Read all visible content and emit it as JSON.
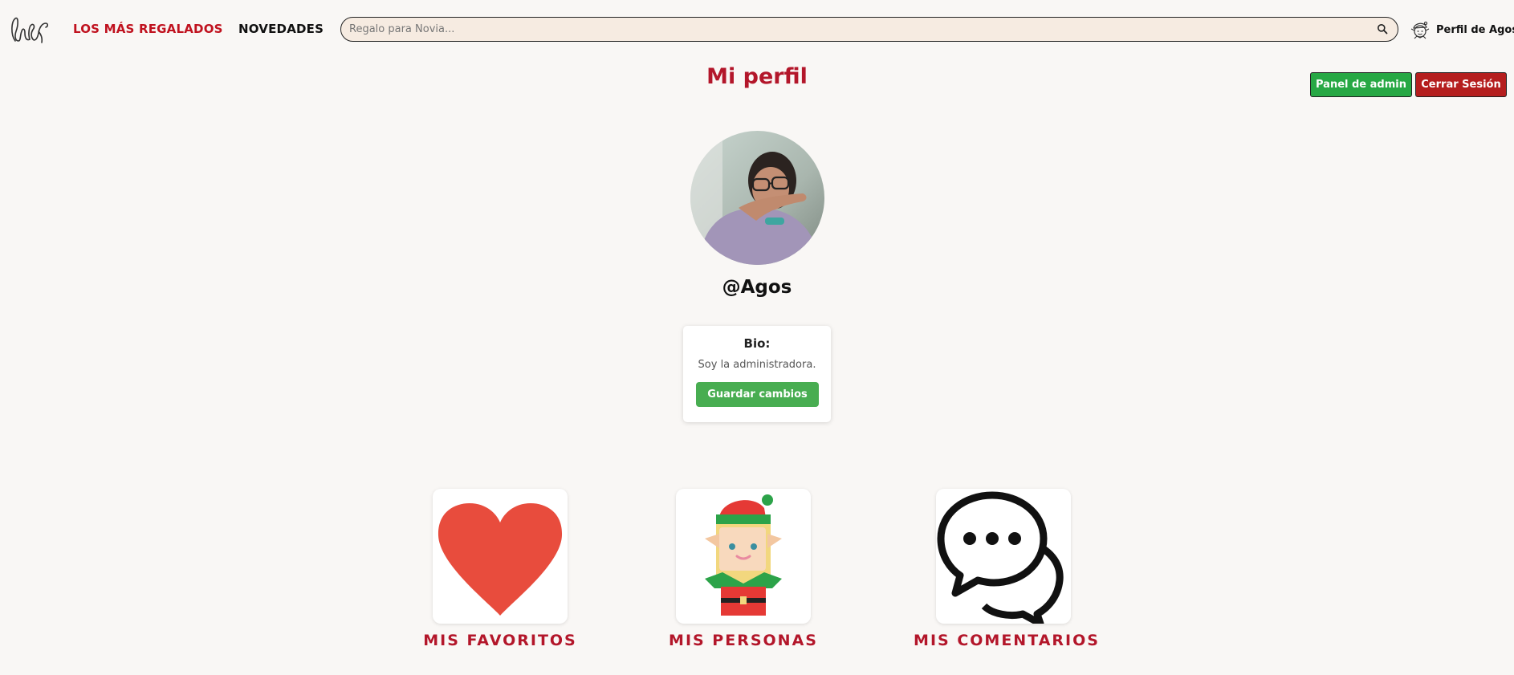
{
  "header": {
    "nav": {
      "top_gifts": "LOS MÁS REGALADOS",
      "news": "NOVEDADES"
    },
    "search": {
      "placeholder": "Regalo para Novia...",
      "value": ""
    },
    "profile_link": "Perfil de Agos"
  },
  "page": {
    "title": "Mi perfil",
    "admin_button": "Panel de admin",
    "logout_button": "Cerrar Sesión"
  },
  "profile": {
    "username": "@Agos",
    "bio_label": "Bio:",
    "bio_text": "Soy la administradora.",
    "save_button": "Guardar cambios"
  },
  "cards": {
    "favorites": {
      "label": "MIS FAVORITOS",
      "icon": "heart-icon"
    },
    "people": {
      "label": "MIS PERSONAS",
      "icon": "elf-icon"
    },
    "comments": {
      "label": "MIS COMENTARIOS",
      "icon": "chat-bubbles-icon"
    }
  },
  "colors": {
    "brand_red": "#b3162a",
    "admin_green": "#27a844",
    "logout_red": "#b51e1e",
    "save_green": "#48ad51",
    "search_bg": "#f6ebe1",
    "page_bg": "#f9f7f5"
  }
}
